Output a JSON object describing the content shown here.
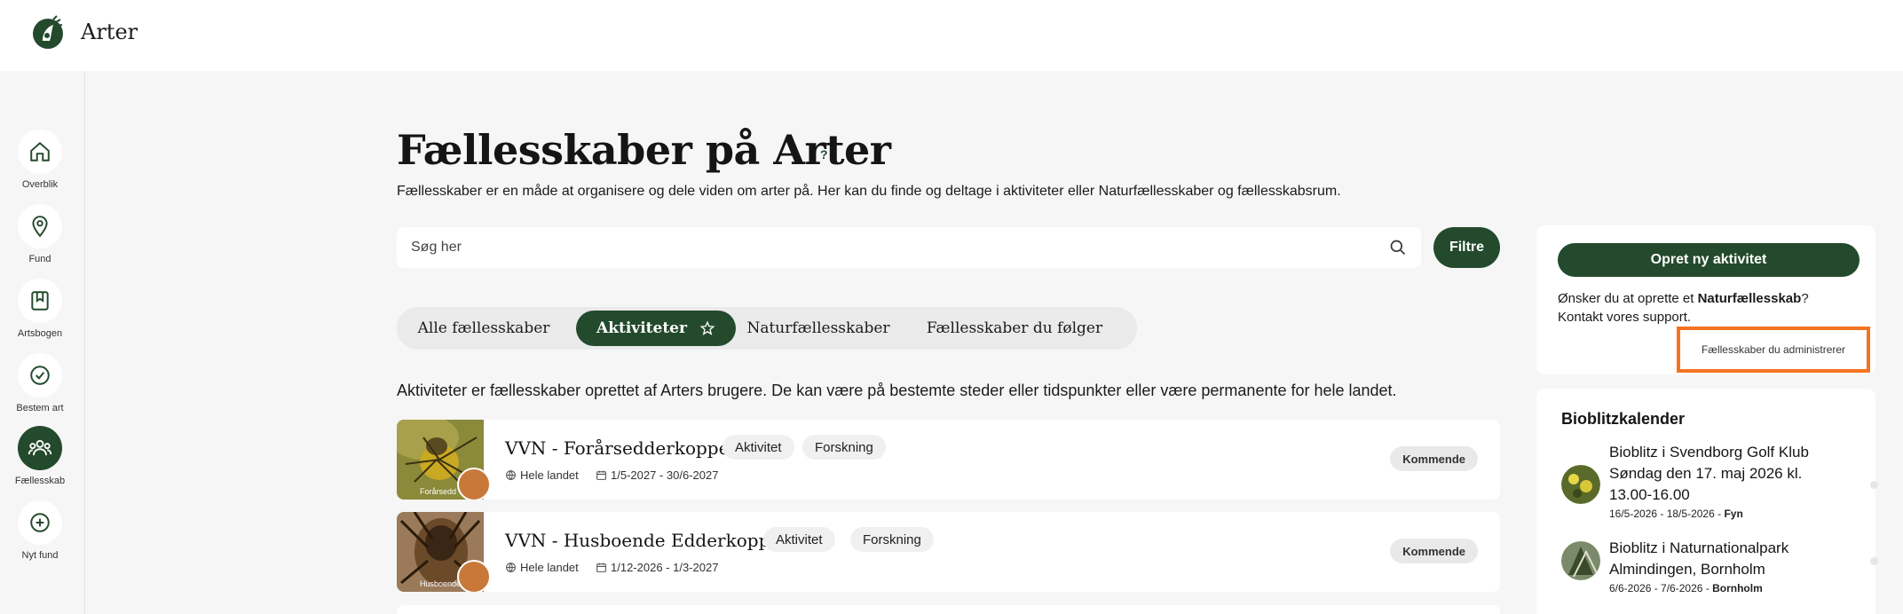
{
  "app": {
    "title": "Arter"
  },
  "colors": {
    "brand_green": "#234a2c",
    "highlight_orange": "#f47321",
    "background": "#f6f6f7"
  },
  "sidebar": {
    "items": [
      {
        "label": "Overblik",
        "icon": "home-icon",
        "active": false
      },
      {
        "label": "Fund",
        "icon": "location-pin-icon",
        "active": false
      },
      {
        "label": "Artsbogen",
        "icon": "bookmark-book-icon",
        "active": false
      },
      {
        "label": "Bestem art",
        "icon": "check-circle-icon",
        "active": false
      },
      {
        "label": "Fællesskab",
        "icon": "community-icon",
        "active": true
      },
      {
        "label": "Nyt fund",
        "icon": "plus-circle-icon",
        "active": false
      }
    ]
  },
  "page": {
    "title": "Fællesskaber på Arter",
    "help": "?",
    "subtitle": "Fællesskaber er en måde at organisere og dele viden om arter på. Her kan du finde og deltage i aktiviteter eller Naturfællesskaber og fællesskabsrum."
  },
  "search": {
    "placeholder": "Søg her",
    "value": ""
  },
  "filter_button": "Filtre",
  "tabs": [
    {
      "label": "Alle fællesskaber",
      "active": false
    },
    {
      "label": "Aktiviteter",
      "active": true,
      "icon": "star-outline-icon"
    },
    {
      "label": "Naturfællesskaber",
      "active": false
    },
    {
      "label": "Fællesskaber du følger",
      "active": false
    }
  ],
  "description": "Aktiviteter er fællesskaber oprettet af Arters brugere. De kan være på bestemte steder eller tidspunkter eller være permanente for hele landet.",
  "activities": [
    {
      "title": "VVN - Forårsedderkopper",
      "tags": [
        "Aktivitet",
        "Forskning"
      ],
      "location": "Hele landet",
      "dates": "1/5-2027 - 30/6-2027",
      "status": "Kommende",
      "image_caption": "Forårsedd"
    },
    {
      "title": "VVN - Husboende Edderkopper",
      "tags": [
        "Aktivitet",
        "Forskning"
      ],
      "location": "Hele landet",
      "dates": "1/12-2026 - 1/3-2027",
      "status": "Kommende",
      "image_caption": "Husboende"
    }
  ],
  "side_panel": {
    "create_button": "Opret ny aktivitet",
    "text_prefix": "Ønsker du at oprette et ",
    "text_bold": "Naturfællesskab",
    "text_suffix": "?",
    "text_line2": "Kontakt vores support.",
    "admin_link": "Fællesskaber du administrerer"
  },
  "calendar": {
    "title": "Bioblitzkalender",
    "items": [
      {
        "name": "Bioblitz i Svendborg Golf Klub Søndag den 17. maj 2026 kl. 13.00-16.00",
        "dates": "16/5-2026 - 18/5-2026",
        "region": "Fyn"
      },
      {
        "name": "Bioblitz i Naturnationalpark Almindingen, Bornholm",
        "dates": "6/6-2026 - 7/6-2026",
        "region": "Bornholm"
      }
    ],
    "date_separator": " - "
  }
}
